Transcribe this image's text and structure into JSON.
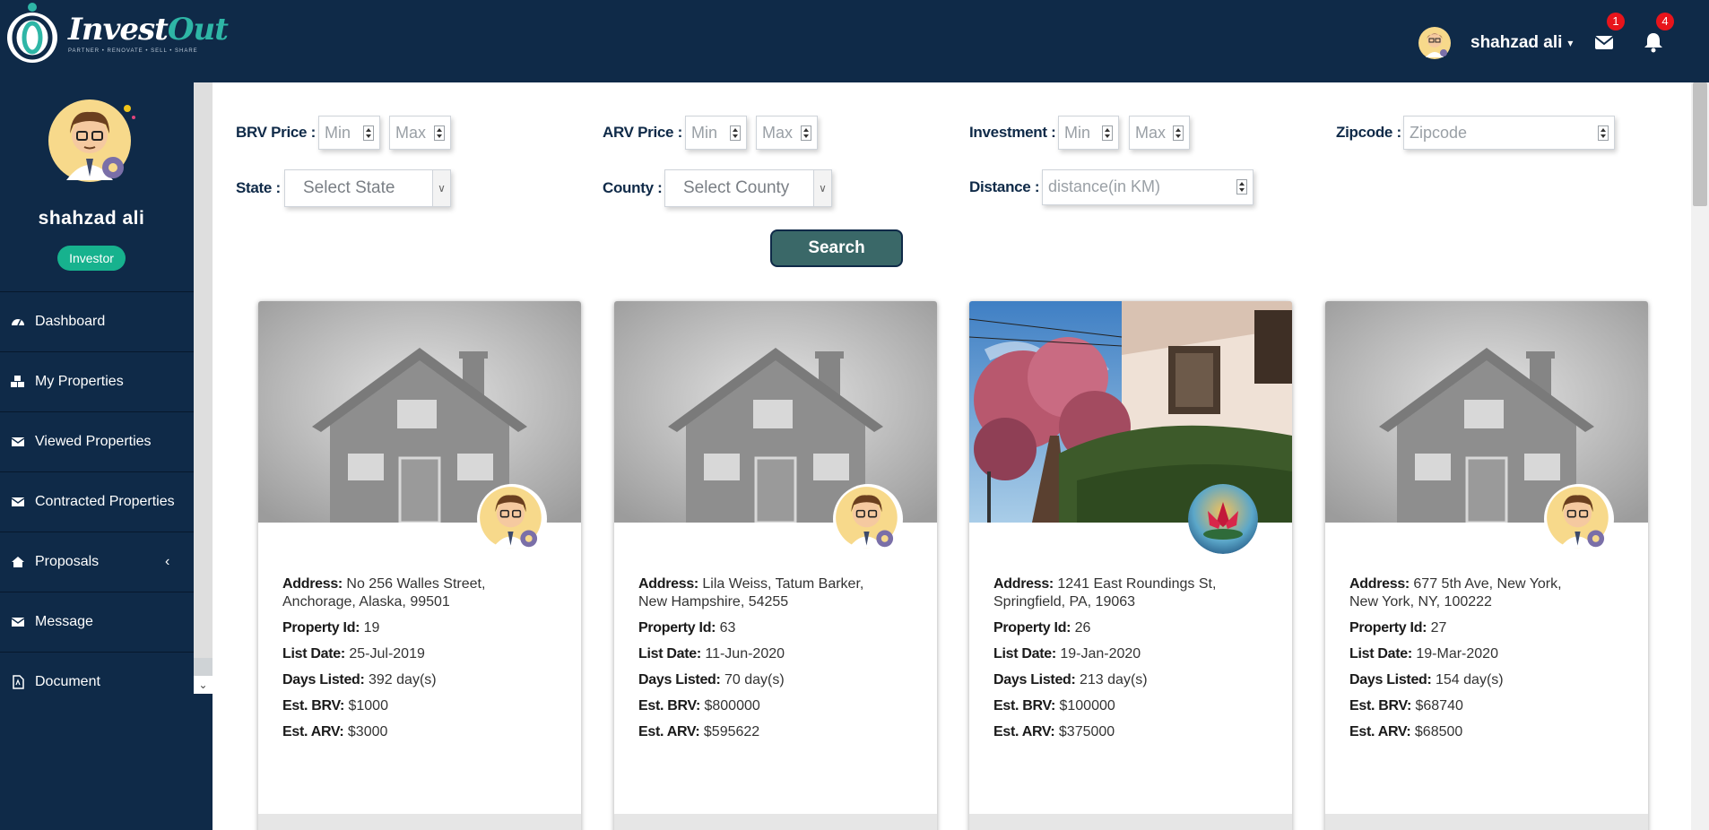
{
  "brand": {
    "name_part1": "Invest",
    "name_part2": "Out",
    "tagline": "PARTNER • RENOVATE • SELL • SHARE"
  },
  "header": {
    "user_name": "shahzad ali",
    "caret": "▾",
    "messages_badge": "1",
    "notifications_badge": "4"
  },
  "sidebar": {
    "user_name": "shahzad ali",
    "role": "Investor",
    "items": [
      {
        "label": "Dashboard",
        "icon": "dashboard-icon"
      },
      {
        "label": "My Properties",
        "icon": "cubes-icon"
      },
      {
        "label": "Viewed Properties",
        "icon": "envelope-icon"
      },
      {
        "label": "Contracted Properties",
        "icon": "envelope-icon"
      },
      {
        "label": "Proposals",
        "icon": "home-icon",
        "chevron": "‹"
      },
      {
        "label": "Message",
        "icon": "envelope-icon"
      },
      {
        "label": "Document",
        "icon": "pdf-file-icon"
      }
    ]
  },
  "filters": {
    "brv_label": "BRV Price :",
    "arv_label": "ARV Price :",
    "investment_label": "Investment :",
    "zipcode_label": "Zipcode :",
    "state_label": "State :",
    "county_label": "County :",
    "distance_label": "Distance :",
    "min_placeholder": "Min",
    "max_placeholder": "Max",
    "zipcode_placeholder": "Zipcode",
    "state_value": "Select State",
    "county_value": "Select County",
    "distance_placeholder": "distance(in KM)",
    "search_label": "Search"
  },
  "labels": {
    "address": "Address:",
    "property_id": "Property Id:",
    "list_date": "List Date:",
    "days_listed": "Days Listed:",
    "est_brv": "Est. BRV:",
    "est_arv": "Est. ARV:"
  },
  "cards": [
    {
      "address_line1": "No 256 Walles Street,",
      "address_line2": "Anchorage, Alaska, 99501",
      "property_id": "19",
      "list_date": "25-Jul-2019",
      "days_listed": "392 day(s)",
      "brv": "$1000",
      "arv": "$3000",
      "image": "house-placeholder",
      "owner": "user-avatar"
    },
    {
      "address_line1": "Lila Weiss, Tatum Barker,",
      "address_line2": "New Hampshire, 54255",
      "property_id": "63",
      "list_date": "11-Jun-2020",
      "days_listed": "70 day(s)",
      "brv": "$800000",
      "arv": "$595622",
      "image": "house-placeholder",
      "owner": "user-avatar"
    },
    {
      "address_line1": "1241 East Roundings St,",
      "address_line2": "Springfield, PA, 19063",
      "property_id": "26",
      "list_date": "19-Jan-2020",
      "days_listed": "213 day(s)",
      "brv": "$100000",
      "arv": "$375000",
      "image": "street-photo",
      "owner": "lotus-avatar"
    },
    {
      "address_line1": "677 5th Ave, New York,",
      "address_line2": "New York, NY, 100222",
      "property_id": "27",
      "list_date": "19-Mar-2020",
      "days_listed": "154 day(s)",
      "brv": "$68740",
      "arv": "$68500",
      "image": "house-placeholder",
      "owner": "user-avatar"
    }
  ],
  "colors": {
    "navy": "#0f2a48",
    "teal": "#2eb6a6",
    "role_badge": "#17b28e",
    "search_button": "#3a6868",
    "badge_red": "#e8141b"
  }
}
